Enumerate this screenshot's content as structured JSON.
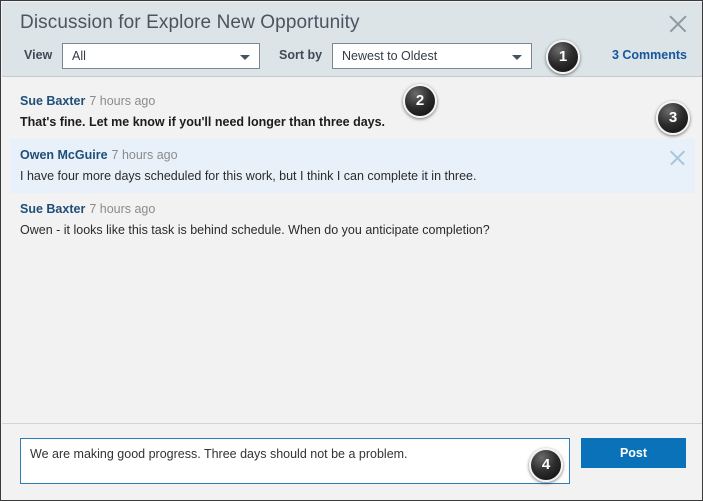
{
  "dialog": {
    "title": "Discussion for Explore New Opportunity",
    "close_icon": "close-icon"
  },
  "toolbar": {
    "view_label": "View",
    "view_value": "All",
    "view_options": [
      "All"
    ],
    "sort_label": "Sort by",
    "sort_value": "Newest to Oldest",
    "sort_options": [
      "Newest to Oldest"
    ],
    "comments_count_label": "3 Comments",
    "caret_icon": "chevron-down-icon"
  },
  "comments": [
    {
      "author": "Sue Baxter",
      "timestamp": "7 hours ago",
      "body": "That's fine. Let me know if you'll need longer than three days.",
      "unread": true,
      "highlighted": false,
      "dismissible": false
    },
    {
      "author": "Owen McGuire",
      "timestamp": "7 hours ago",
      "body": "I have four more days scheduled for this work, but I think I can complete it in three.",
      "unread": false,
      "highlighted": true,
      "dismissible": true,
      "dismiss_icon": "close-icon"
    },
    {
      "author": "Sue Baxter",
      "timestamp": "7 hours ago",
      "body": "Owen - it looks like this task is behind schedule. When do you anticipate completion?",
      "unread": false,
      "highlighted": false,
      "dismissible": false
    }
  ],
  "compose": {
    "value": "We are making good progress. Three days should not be a problem.",
    "placeholder": "",
    "post_label": "Post"
  },
  "callouts": [
    {
      "number": "1"
    },
    {
      "number": "2"
    },
    {
      "number": "3"
    },
    {
      "number": "4"
    }
  ],
  "colors": {
    "header_bg": "#dce4e8",
    "list_bg": "#f2f2f2",
    "highlight_bg": "#e8f1f9",
    "author_blue": "#1f4e79",
    "link_blue": "#17569b",
    "post_blue": "#0a72b8",
    "focus_border": "#2b7fb8"
  }
}
